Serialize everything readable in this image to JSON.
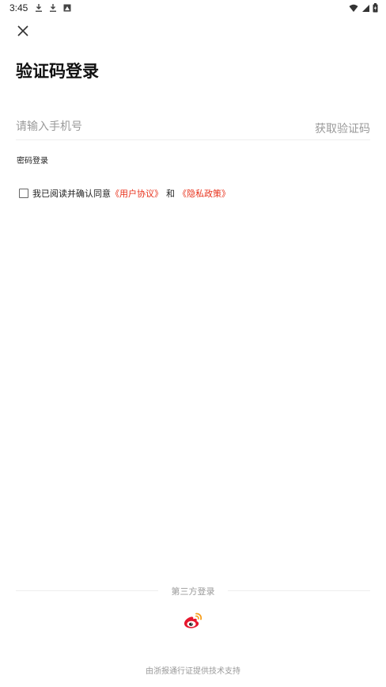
{
  "status_bar": {
    "time": "3:45",
    "left_icons": [
      "download-icon",
      "download-icon",
      "image-icon"
    ],
    "right_icons": [
      "wifi-icon",
      "signal-icon",
      "battery-icon"
    ]
  },
  "header": {
    "close_icon": "close-icon",
    "title": "验证码登录"
  },
  "form": {
    "phone_placeholder": "请输入手机号",
    "phone_value": "",
    "get_code_label": "获取验证码",
    "password_login_label": "密码登录"
  },
  "agreement": {
    "checked": false,
    "prefix": "我已阅读并确认同意",
    "user_agreement": "《用户协议》",
    "and": "和",
    "privacy_policy": "《隐私政策》"
  },
  "third_party": {
    "label": "第三方登录",
    "providers": [
      "weibo-icon"
    ]
  },
  "footer": {
    "note": "由浙报通行证提供技术支持"
  },
  "colors": {
    "accent_link": "#e8321c",
    "hint_gray": "#9a9a9a",
    "weibo_red": "#e6162d",
    "weibo_orange": "#f79e1b"
  }
}
